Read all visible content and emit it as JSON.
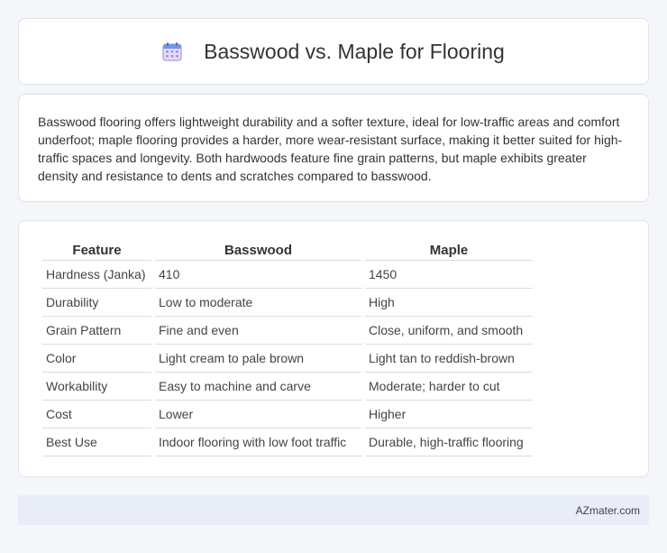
{
  "header": {
    "icon": "calendar-icon",
    "title": "Basswood vs. Maple for Flooring"
  },
  "summary": {
    "text": "Basswood flooring offers lightweight durability and a softer texture, ideal for low-traffic areas and comfort underfoot; maple flooring provides a harder, more wear-resistant surface, making it better suited for high-traffic spaces and longevity. Both hardwoods feature fine grain patterns, but maple exhibits greater density and resistance to dents and scratches compared to basswood."
  },
  "table": {
    "headers": [
      "Feature",
      "Basswood",
      "Maple"
    ],
    "rows": [
      [
        "Hardness (Janka)",
        "410",
        "1450"
      ],
      [
        "Durability",
        "Low to moderate",
        "High"
      ],
      [
        "Grain Pattern",
        "Fine and even",
        "Close, uniform, and smooth"
      ],
      [
        "Color",
        "Light cream to pale brown",
        "Light tan to reddish-brown"
      ],
      [
        "Workability",
        "Easy to machine and carve",
        "Moderate; harder to cut"
      ],
      [
        "Cost",
        "Lower",
        "Higher"
      ],
      [
        "Best Use",
        "Indoor flooring with low foot traffic",
        "Durable, high-traffic flooring"
      ]
    ]
  },
  "footer": {
    "text": "AZmater.com"
  }
}
